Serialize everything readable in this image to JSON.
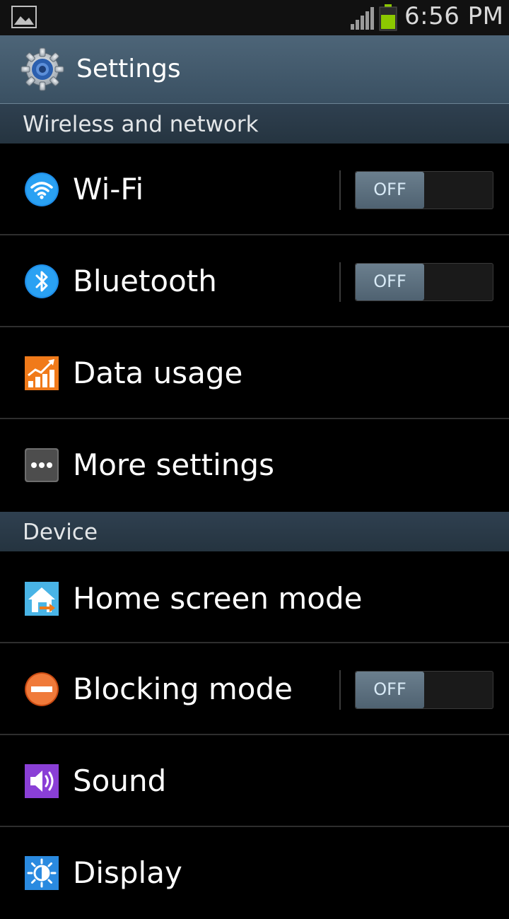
{
  "status_bar": {
    "time": "6:56 PM",
    "icons": [
      "gallery-notification-icon",
      "signal-strength-icon",
      "battery-icon"
    ],
    "battery_color": "#8cc800"
  },
  "action_bar": {
    "title": "Settings",
    "icon": "settings-gear-icon"
  },
  "sections": [
    {
      "title": "Wireless and network"
    },
    {
      "title": "Device"
    }
  ],
  "items": [
    {
      "label": "Wi-Fi",
      "icon": "wifi-icon",
      "toggle": "OFF"
    },
    {
      "label": "Bluetooth",
      "icon": "bluetooth-icon",
      "toggle": "OFF"
    },
    {
      "label": "Data usage",
      "icon": "data-usage-icon"
    },
    {
      "label": "More settings",
      "icon": "more-settings-icon"
    },
    {
      "label": "Home screen mode",
      "icon": "home-screen-mode-icon"
    },
    {
      "label": "Blocking mode",
      "icon": "blocking-mode-icon",
      "toggle": "OFF"
    },
    {
      "label": "Sound",
      "icon": "sound-icon"
    },
    {
      "label": "Display",
      "icon": "display-icon"
    }
  ],
  "colors": {
    "action_bar": "#45596b",
    "section_header": "#2b3a47",
    "toggle_knob": "#5f7382"
  }
}
